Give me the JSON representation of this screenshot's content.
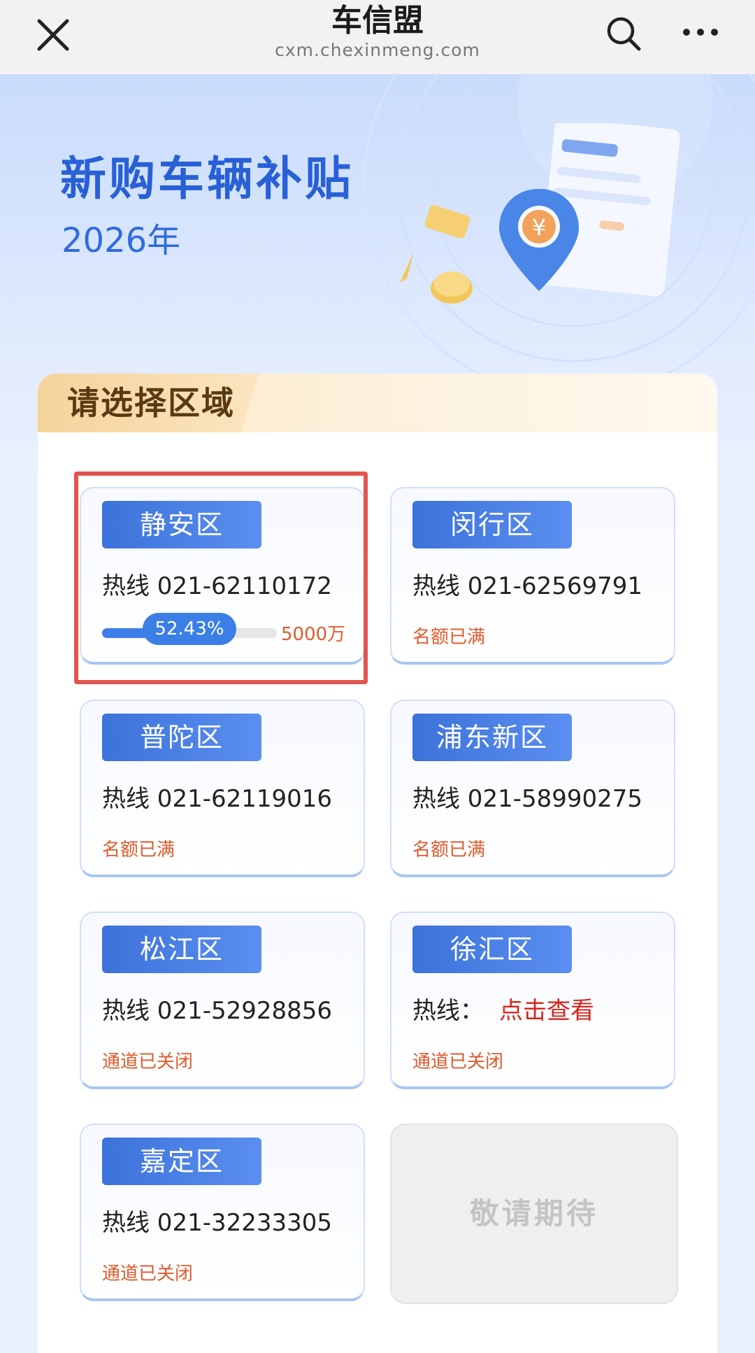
{
  "app": {
    "title": "车信盟",
    "url": "cxm.chexinmeng.com"
  },
  "hero": {
    "title": "新购车辆补贴",
    "year": "2026年"
  },
  "section": {
    "title": "请选择区域"
  },
  "districts": [
    {
      "name": "静安区",
      "hotline": "热线 021-62110172",
      "progress_percent": 52.43,
      "progress_label": "52.43%",
      "amount": "5000万",
      "highlighted": true
    },
    {
      "name": "闵行区",
      "hotline": "热线 021-62569791",
      "status": "名额已满"
    },
    {
      "name": "普陀区",
      "hotline": "热线 021-62119016",
      "status": "名额已满"
    },
    {
      "name": "浦东新区",
      "hotline": "热线 021-58990275",
      "status": "名额已满"
    },
    {
      "name": "松江区",
      "hotline": "热线 021-52928856",
      "status": "通道已关闭"
    },
    {
      "name": "徐汇区",
      "hotline_label": "热线：",
      "hotline_link": "点击查看",
      "status": "通道已关闭"
    },
    {
      "name": "嘉定区",
      "hotline": "热线 021-32233305",
      "status": "通道已关闭"
    }
  ],
  "coming_soon": "敬请期待",
  "colors": {
    "primary": "#3c73da",
    "status": "#e05a2c",
    "highlight": "#e25450",
    "link_red": "#d8261c"
  },
  "icons": [
    "close-icon",
    "search-icon",
    "more-icon",
    "location-yuan-icon",
    "document-icon",
    "coin-icon"
  ]
}
